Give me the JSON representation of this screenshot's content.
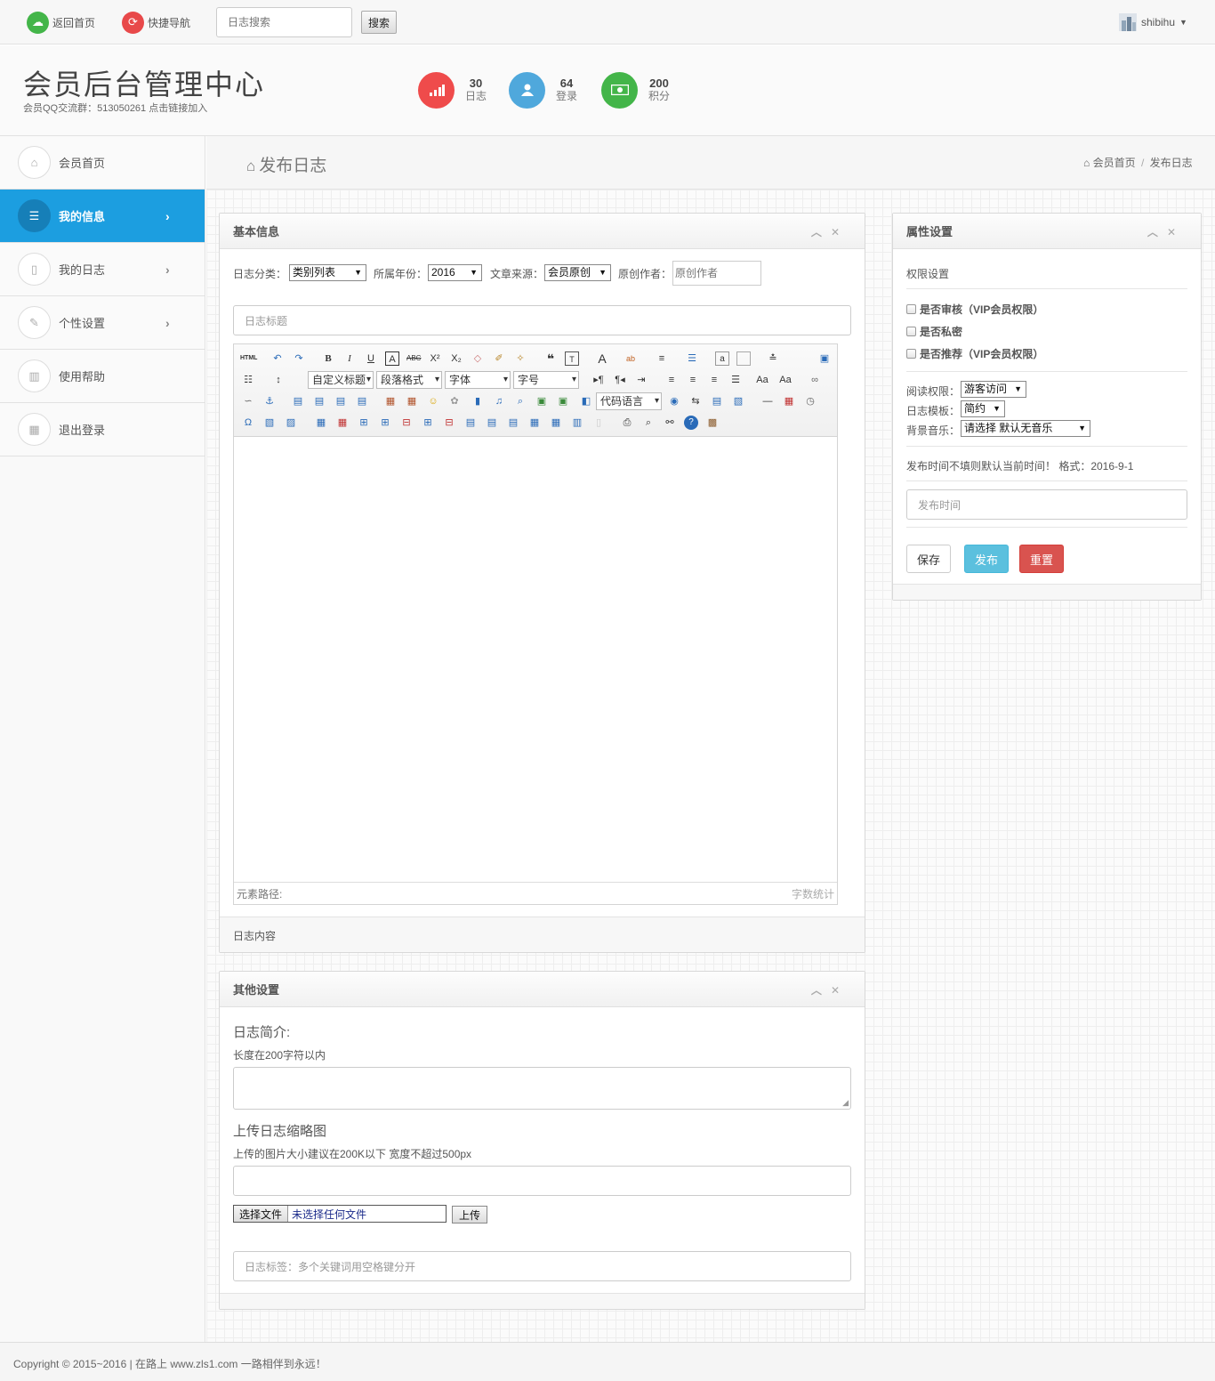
{
  "topbar": {
    "home_label": "返回首页",
    "quicknav_label": "快捷导航",
    "search_placeholder": "日志搜索",
    "search_button": "搜索",
    "username": "shibihu"
  },
  "header": {
    "title": "会员后台管理中心",
    "subtitle": "会员QQ交流群：513050261 点击链接加入",
    "stats": [
      {
        "value": "30",
        "label": "日志",
        "color": "#ef4b4b"
      },
      {
        "value": "64",
        "label": "登录",
        "color": "#4fa8dc"
      },
      {
        "value": "200",
        "label": "积分",
        "color": "#43b549"
      }
    ]
  },
  "sidebar": {
    "items": [
      {
        "label": "会员首页",
        "icon": "home-icon"
      },
      {
        "label": "我的信息",
        "icon": "list-icon",
        "active": true
      },
      {
        "label": "我的日志",
        "icon": "file-icon"
      },
      {
        "label": "个性设置",
        "icon": "wand-icon"
      },
      {
        "label": "使用帮助",
        "icon": "chart-icon"
      },
      {
        "label": "退出登录",
        "icon": "calendar-icon"
      }
    ]
  },
  "page": {
    "title": "发布日志",
    "breadcrumb_home": "会员首页",
    "breadcrumb_sep": "/",
    "breadcrumb_current": "发布日志"
  },
  "basic": {
    "title": "基本信息",
    "category_label": "日志分类：",
    "category_value": "类别列表",
    "year_label": "所属年份：",
    "year_value": "2016",
    "source_label": "文章来源：",
    "source_value": "会员原创",
    "author_label": "原创作者：",
    "author_placeholder": "原创作者",
    "title_placeholder": "日志标题",
    "editor_selects": {
      "custom_title": "自定义标题",
      "paragraph": "段落格式",
      "font": "字体",
      "size": "字号",
      "code": "代码语言"
    },
    "element_path": "元素路径:",
    "word_count": "字数统计",
    "footer": "日志内容"
  },
  "other": {
    "title": "其他设置",
    "summary_heading": "日志简介:",
    "summary_hint": "长度在200字符以内",
    "thumb_heading": "上传日志缩略图",
    "thumb_hint": "上传的图片大小建议在200K以下 宽度不超过500px",
    "choose_file": "选择文件",
    "no_file": "未选择任何文件",
    "upload": "上传",
    "tags_placeholder": "日志标签：多个关键词用空格键分开"
  },
  "attr": {
    "title": "属性设置",
    "perm_heading": "权限设置",
    "checkboxes": [
      "是否审核（VIP会员权限）",
      "是否私密",
      "是否推荐（VIP会员权限）"
    ],
    "read_label": "阅读权限：",
    "read_value": "游客访问",
    "template_label": "日志模板：",
    "template_value": "简约",
    "music_label": "背景音乐：",
    "music_value": "请选择 默认无音乐",
    "time_hint": "发布时间不填则默认当前时间！ 格式：2016-9-1",
    "time_placeholder": "发布时间",
    "save": "保存",
    "publish": "发布",
    "reset": "重置"
  },
  "footer": {
    "copyright": "Copyright © 2015~2016 | 在路上 www.zls1.com 一路相伴到永远！"
  }
}
